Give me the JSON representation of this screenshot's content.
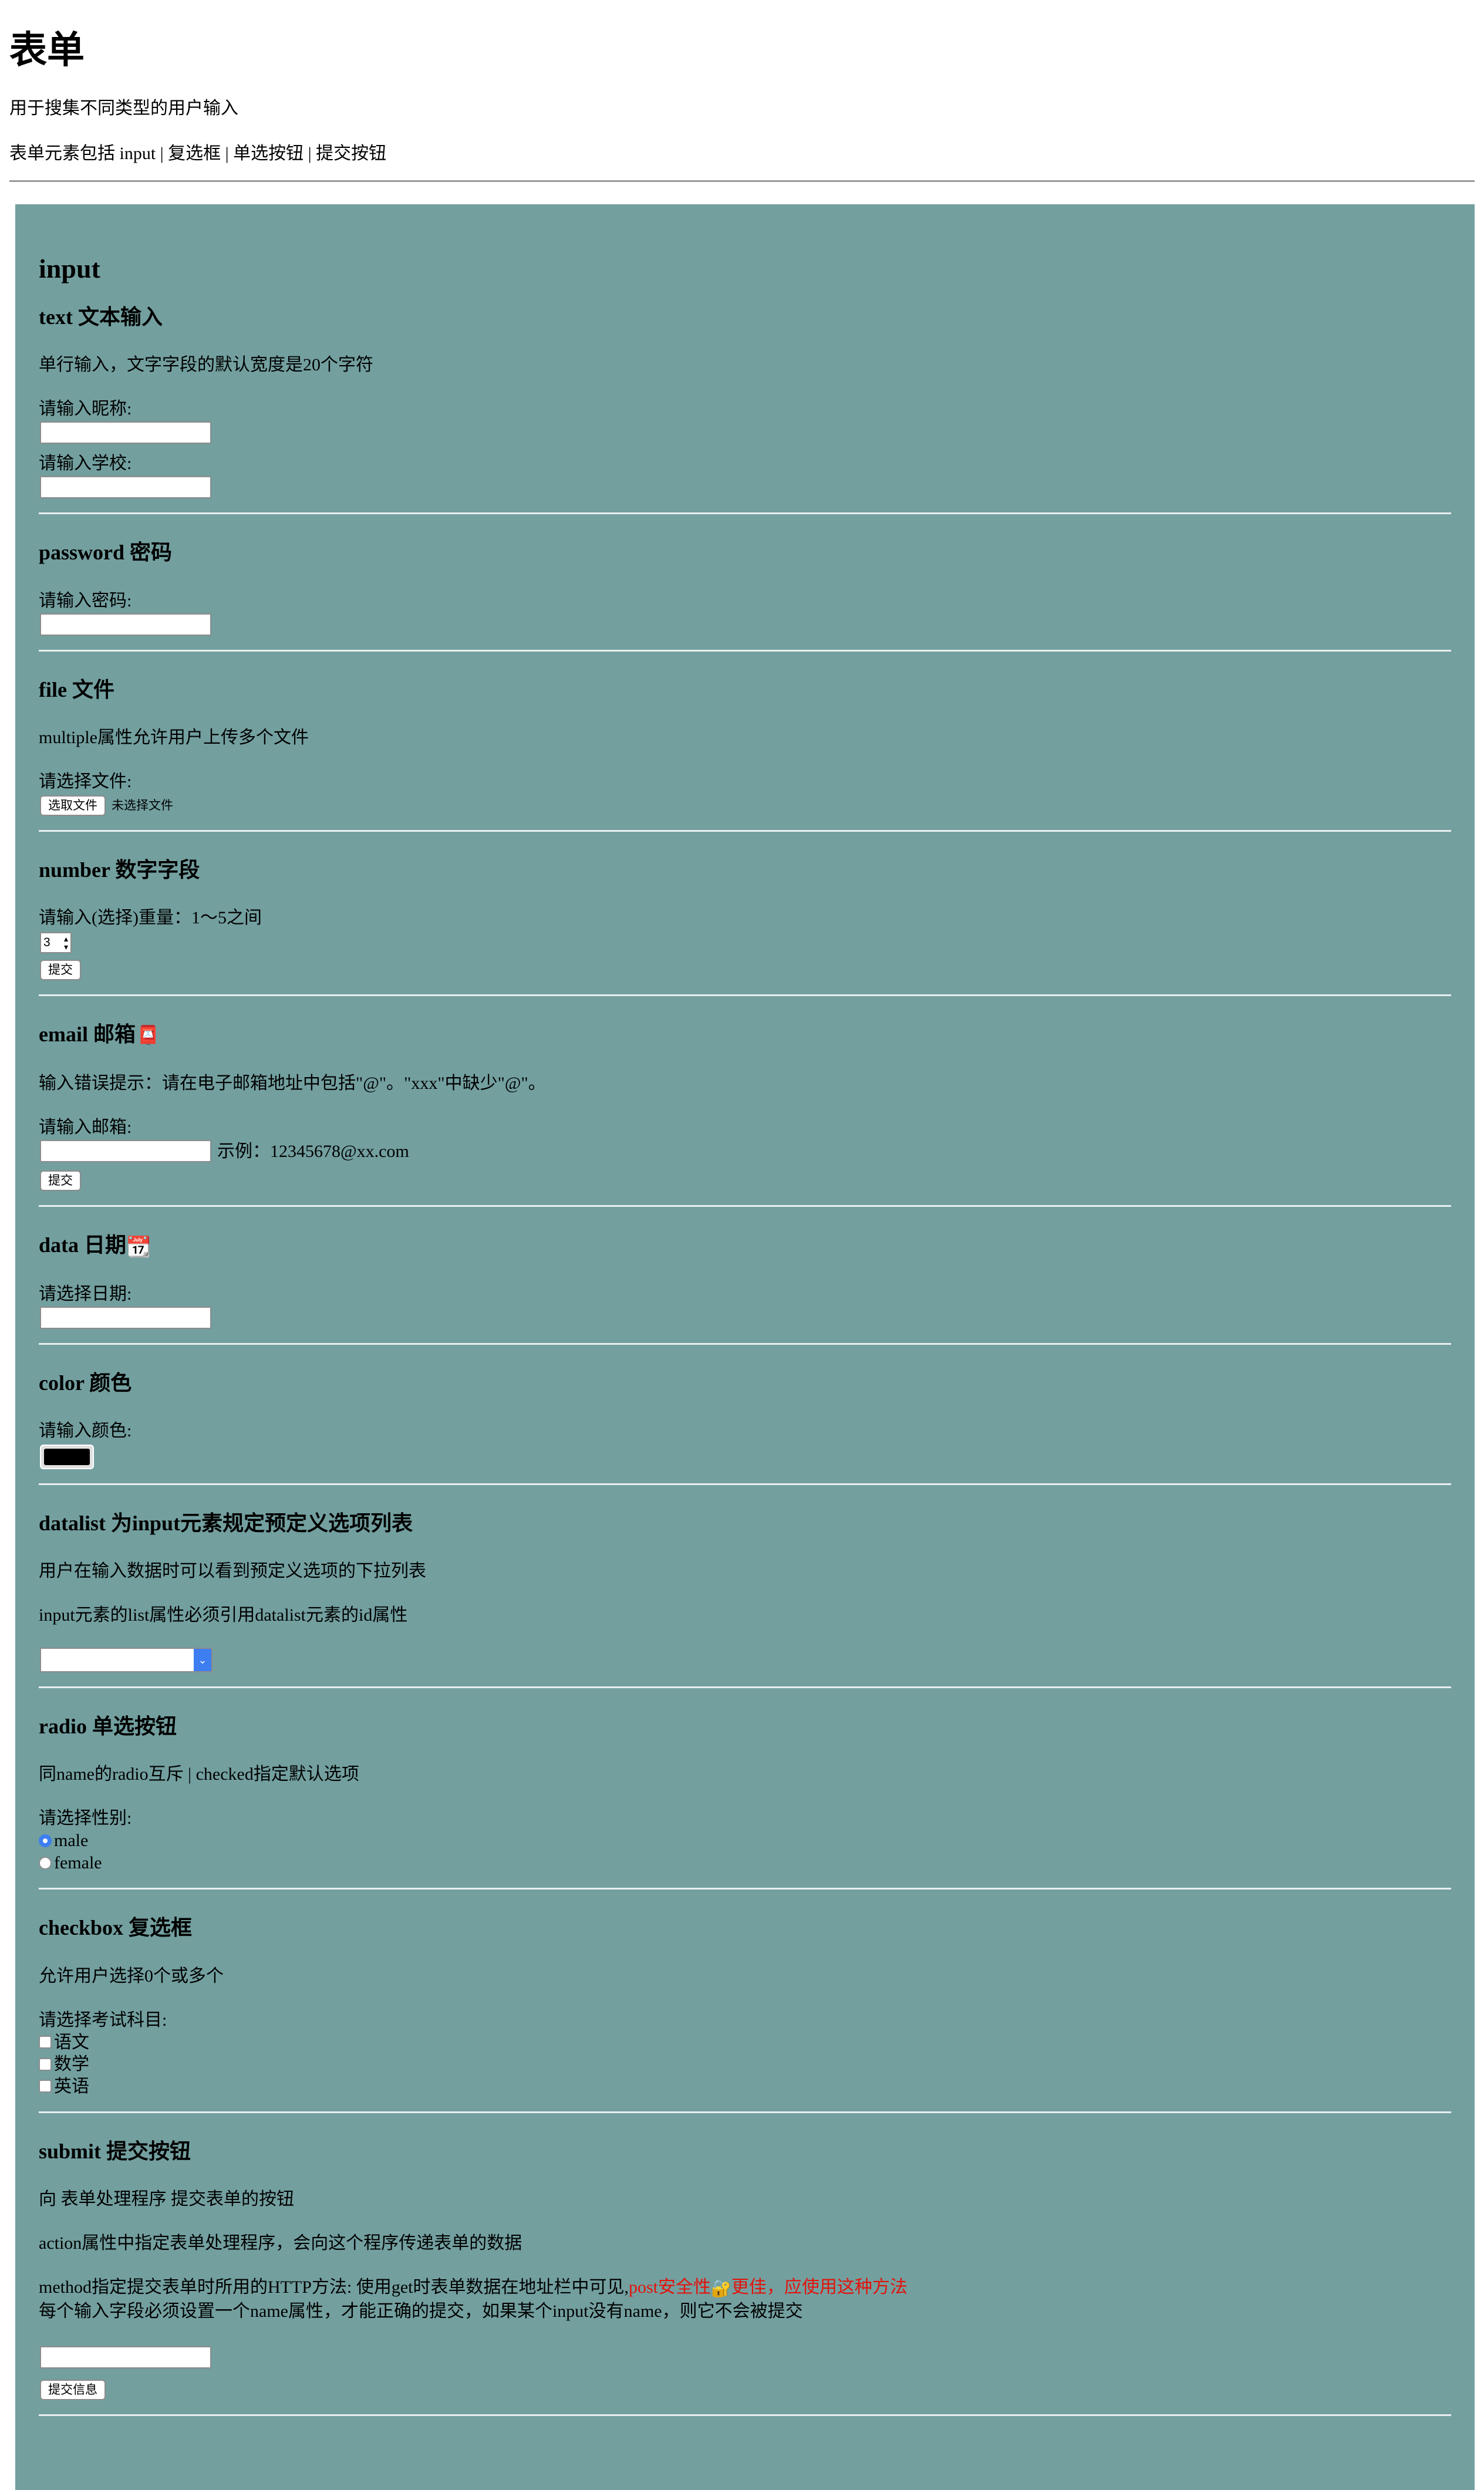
{
  "header": {
    "title": "表单",
    "subtitle": "用于搜集不同类型的用户输入",
    "elements_line": "表单元素包括 input | 复选框 | 单选按钮 | 提交按钮"
  },
  "input_section": {
    "title": "input"
  },
  "text_section": {
    "title": "text 文本输入",
    "desc": "单行输入，文字字段的默认宽度是20个字符",
    "nickname_label": "请输入昵称:",
    "school_label": "请输入学校:"
  },
  "password_section": {
    "title": "password 密码",
    "password_label": "请输入密码:"
  },
  "file_section": {
    "title": "file 文件",
    "desc": "multiple属性允许用户上传多个文件",
    "file_label": "请选择文件:",
    "choose_button": "选取文件",
    "no_file_text": "未选择文件"
  },
  "number_section": {
    "title": "number 数字字段",
    "number_label": "请输入(选择)重量：1～5之间",
    "value": "3",
    "submit_label": "提交"
  },
  "email_section": {
    "title": "email 邮箱",
    "icon": "📮",
    "error_hint": "输入错误提示：请在电子邮箱地址中包括\"@\"。\"xxx\"中缺少\"@\"。",
    "email_label": "请输入邮箱:",
    "example": "示例：12345678@xx.com",
    "submit_label": "提交"
  },
  "date_section": {
    "title": "data 日期",
    "icon": "📆",
    "date_label": "请选择日期:"
  },
  "color_section": {
    "title": "color 颜色",
    "color_label": "请输入颜色:",
    "value": "#000000"
  },
  "datalist_section": {
    "title": "datalist 为input元素规定预定义选项列表",
    "desc1": "用户在输入数据时可以看到预定义选项的下拉列表",
    "desc2": "input元素的list属性必须引用datalist元素的id属性"
  },
  "radio_section": {
    "title": "radio 单选按钮",
    "desc": "同name的radio互斥 | checked指定默认选项",
    "gender_label": "请选择性别:",
    "options": [
      "male",
      "female"
    ],
    "selected": "male"
  },
  "checkbox_section": {
    "title": "checkbox 复选框",
    "desc": "允许用户选择0个或多个",
    "subjects_label": "请选择考试科目:",
    "options": [
      "语文",
      "数学",
      "英语"
    ]
  },
  "submit_section": {
    "title": "submit 提交按钮",
    "desc1": "向 表单处理程序 提交表单的按钮",
    "desc2": "action属性中指定表单处理程序，会向这个程序传递表单的数据",
    "method_text": "method指定提交表单时所用的HTTP方法: 使用get时表单数据在地址栏中可见,",
    "method_red_1": "post安全性",
    "method_icon": "🔐",
    "method_red_2": "更佳，应使用这种方法",
    "name_note": "每个输入字段必须设置一个name属性，才能正确的提交，如果某个input没有name，则它不会被提交",
    "submit_label": "提交信息"
  },
  "colors": {
    "form_background": "#739f9f",
    "accent": "#3d7ef0",
    "warning_red": "#e3120b"
  }
}
